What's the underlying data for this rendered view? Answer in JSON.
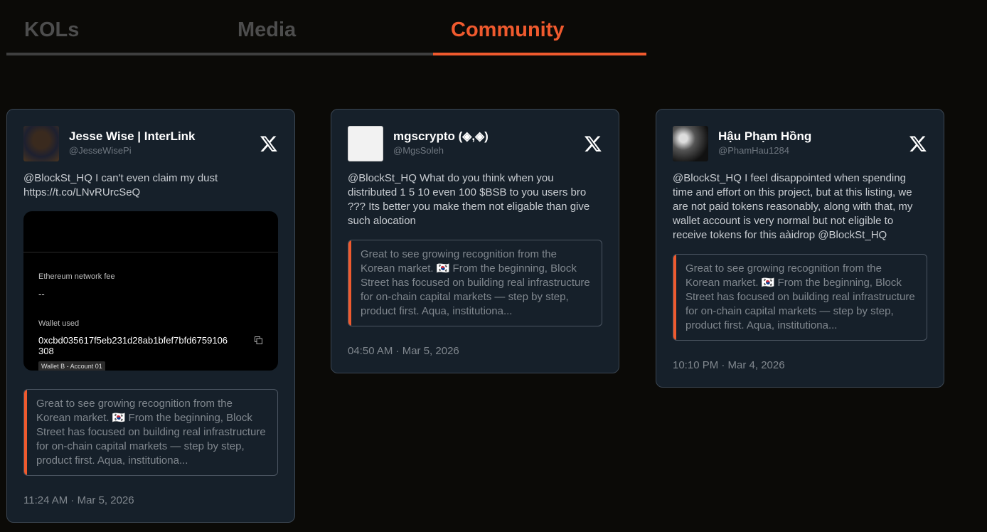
{
  "tabs": [
    {
      "label": "KOLs",
      "active": false
    },
    {
      "label": "Media",
      "active": false
    },
    {
      "label": "Community",
      "active": true
    }
  ],
  "colors": {
    "accent": "#f05a2e",
    "card_bg": "#16202a",
    "page_bg": "#0b0a07"
  },
  "posts": [
    {
      "name": "Jesse Wise | InterLink",
      "handle": "@JesseWisePi",
      "text": "@BlockSt_HQ I can't even claim my dust https://t.co/LNvRUrcSeQ",
      "media": {
        "fee_label": "Ethereum network fee",
        "fee_value": "--",
        "wallet_label": "Wallet used",
        "address": "0xcbd035617f5eb231d28ab1bfef7bfd6759106308",
        "account": "Wallet B - Account 01"
      },
      "quote": "Great to see growing recognition from the Korean market. 🇰🇷 From the beginning, Block Street has focused on building real infrastructure for on-chain capital markets — step by step, product first. Aqua, institutiona...",
      "time": "11:24 AM · Mar 5, 2026"
    },
    {
      "name": "mgscrypto (◈,◈)",
      "handle": "@MgsSoleh",
      "text": "@BlockSt_HQ What do you think when you distributed 1 5 10 even 100 $BSB to you users bro ??? Its better you make them not eligable than give such alocation",
      "quote": "Great to see growing recognition from the Korean market. 🇰🇷 From the beginning, Block Street has focused on building real infrastructure for on-chain capital markets — step by step, product first. Aqua, institutiona...",
      "time": "04:50 AM · Mar 5, 2026"
    },
    {
      "name": "Hậu Phạm Hồng",
      "handle": "@PhamHau1284",
      "text": "@BlockSt_HQ I feel disappointed when spending time and effort on this project, but at this listing, we are not paid tokens reasonably, along with that, my wallet account is very normal but not eligible to receive tokens for this aàidrop @BlockSt_HQ",
      "quote": "Great to see growing recognition from the Korean market. 🇰🇷 From the beginning, Block Street has focused on building real infrastructure for on-chain capital markets — step by step, product first. Aqua, institutiona...",
      "time": "10:10 PM · Mar 4, 2026"
    }
  ]
}
